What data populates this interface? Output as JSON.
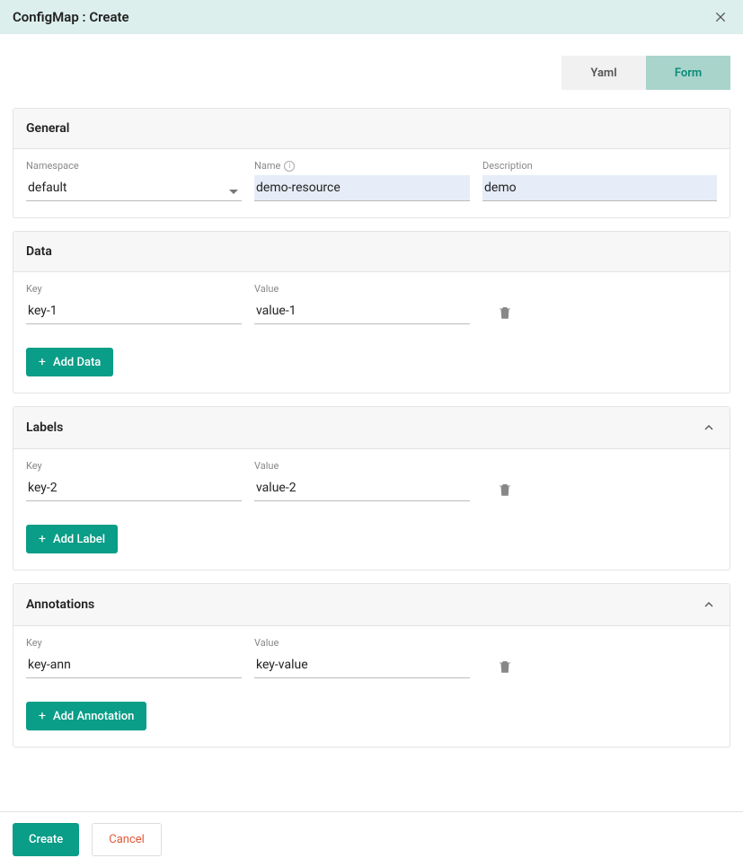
{
  "header": {
    "title": "ConfigMap : Create"
  },
  "tabs": {
    "yaml": "Yaml",
    "form": "Form"
  },
  "general": {
    "title": "General",
    "namespace_label": "Namespace",
    "namespace_value": "default",
    "name_label": "Name",
    "name_value": "demo-resource",
    "description_label": "Description",
    "description_value": "demo"
  },
  "data": {
    "title": "Data",
    "key_label": "Key",
    "value_label": "Value",
    "rows": [
      {
        "key": "key-1",
        "value": "value-1"
      }
    ],
    "add_label": "Add Data"
  },
  "labels": {
    "title": "Labels",
    "key_label": "Key",
    "value_label": "Value",
    "rows": [
      {
        "key": "key-2",
        "value": "value-2"
      }
    ],
    "add_label": "Add Label"
  },
  "annotations": {
    "title": "Annotations",
    "key_label": "Key",
    "value_label": "Value",
    "rows": [
      {
        "key": "key-ann",
        "value": "key-value"
      }
    ],
    "add_label": "Add Annotation"
  },
  "footer": {
    "create": "Create",
    "cancel": "Cancel"
  }
}
